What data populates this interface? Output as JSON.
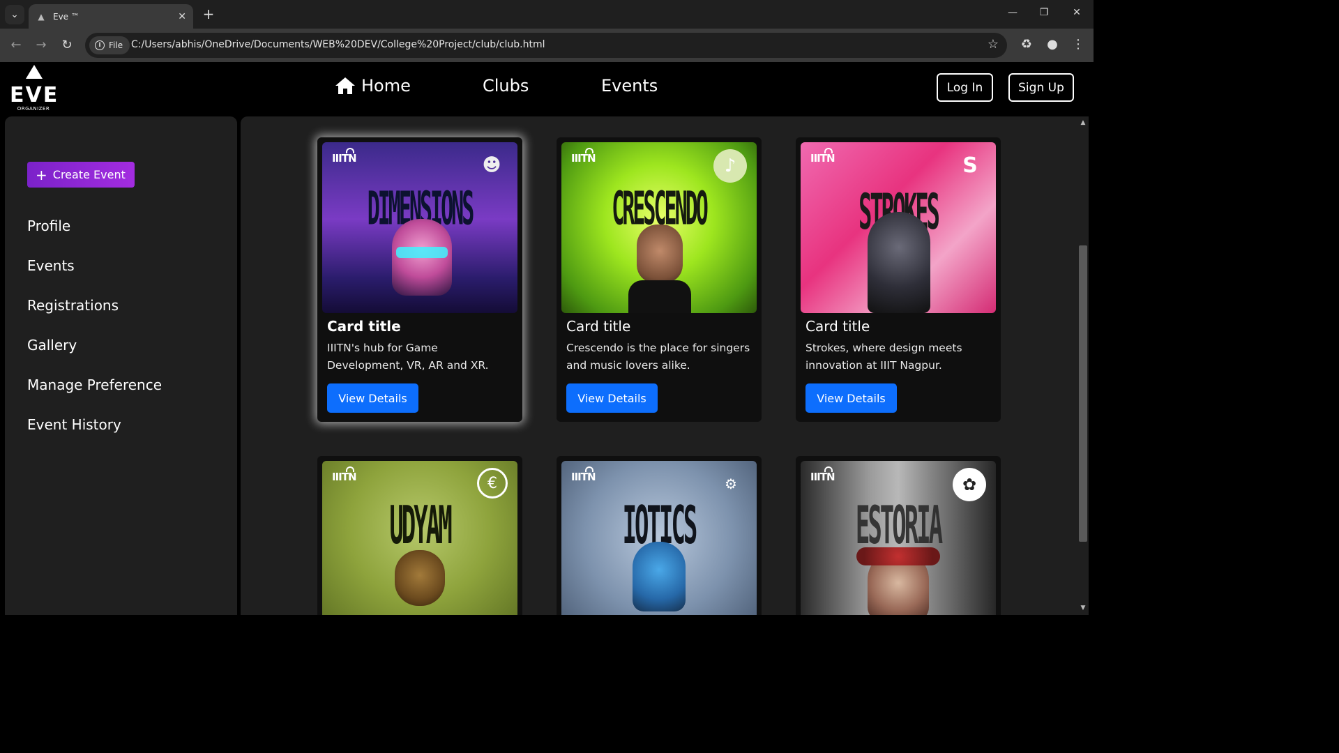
{
  "browser": {
    "tab_title": "Eve ™",
    "address_chip": "File",
    "url": "C:/Users/abhis/OneDrive/Documents/WEB%20DEV/College%20Project/club/club.html"
  },
  "header": {
    "logo_word": "EVE",
    "logo_sub": "ORGANIZER",
    "nav": {
      "home": "Home",
      "clubs": "Clubs",
      "events": "Events"
    },
    "login": "Log In",
    "signup": "Sign Up"
  },
  "sidebar": {
    "create_event": "Create Event",
    "items": [
      "Profile",
      "Events",
      "Registrations",
      "Gallery",
      "Manage Preference",
      "Event History"
    ]
  },
  "cards": [
    {
      "poster_text": "DIMENSIONS",
      "title": "Card title",
      "text": "IIITN's hub for Game Development, VR, AR and XR.",
      "button": "View Details",
      "icon": "vr-headset-icon"
    },
    {
      "poster_text": "CRESCENDO",
      "title": "Card title",
      "text": "Crescendo is the place for singers and music lovers alike.",
      "button": "View Details",
      "icon": "music-note-icon"
    },
    {
      "poster_text": "STROKES",
      "title": "Card title",
      "text": "Strokes, where design meets innovation at IIIT Nagpur.",
      "button": "View Details",
      "icon": "strokes-logo-icon"
    },
    {
      "poster_text": "UDYAM",
      "icon": "coin-logo-icon"
    },
    {
      "poster_text": "IOTICS",
      "icon": "iotics-logo-icon"
    },
    {
      "poster_text": "ESTORIA",
      "icon": "emblem-icon"
    }
  ],
  "poster_brand": "IIITN",
  "colors": {
    "primary_button": "#0d6efd",
    "create_gradient_start": "#7b22c9",
    "create_gradient_end": "#a32ce0",
    "panel": "#1f1f1f"
  }
}
